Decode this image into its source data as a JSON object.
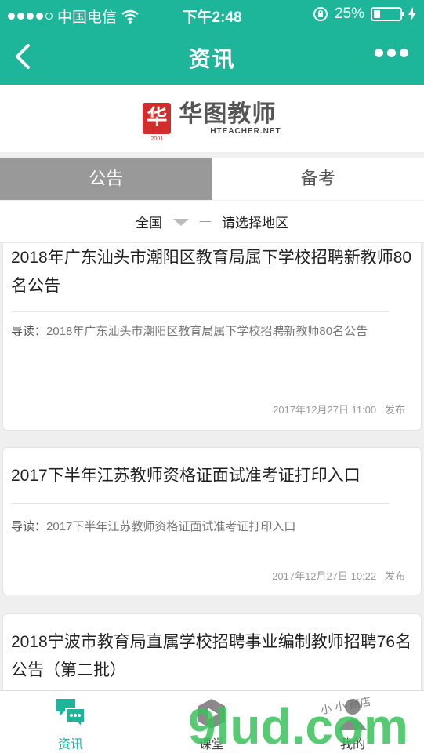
{
  "status": {
    "carrier": "中国电信",
    "time": "下午2:48",
    "battery_text": "25%",
    "battery_level": 0.25
  },
  "nav": {
    "title": "资讯"
  },
  "logo": {
    "mark": "华",
    "since": "SINCE 2001",
    "name_cn": "华图教师",
    "name_en": "HTEACHER.NET"
  },
  "tabs": [
    {
      "label": "公告",
      "active": true
    },
    {
      "label": "备考",
      "active": false
    }
  ],
  "region": {
    "country": "全国",
    "prompt": "请选择地区"
  },
  "articles": [
    {
      "title": "2018年广东汕头市潮阳区教育局属下学校招聘新教师80名公告",
      "lead": "导读：",
      "summary": "2018年广东汕头市潮阳区教育局属下学校招聘新教师80名公告",
      "time": "2017年12月27日 11:00",
      "suffix": "发布"
    },
    {
      "title": "2017下半年江苏教师资格证面试准考证打印入口",
      "lead": "导读：",
      "summary": "2017下半年江苏教师资格证面试准考证打印入口",
      "time": "2017年12月27日 10:22",
      "suffix": "发布"
    },
    {
      "title": "2018宁波市教育局直属学校招聘事业编制教师招聘76名公告（第二批）"
    }
  ],
  "bottom_tabs": [
    {
      "label": "资讯",
      "icon": "chat-bubbles-icon",
      "active": true
    },
    {
      "label": "课堂",
      "icon": "play-icon",
      "active": false
    },
    {
      "label": "我的",
      "icon": "user-icon",
      "active": false
    }
  ],
  "watermark": {
    "text": "9lud.com",
    "script": "小 小 商店"
  },
  "colors": {
    "accent": "#1eb69a",
    "tab_active_bg": "#999999",
    "logo_red": "#d12d2d"
  }
}
